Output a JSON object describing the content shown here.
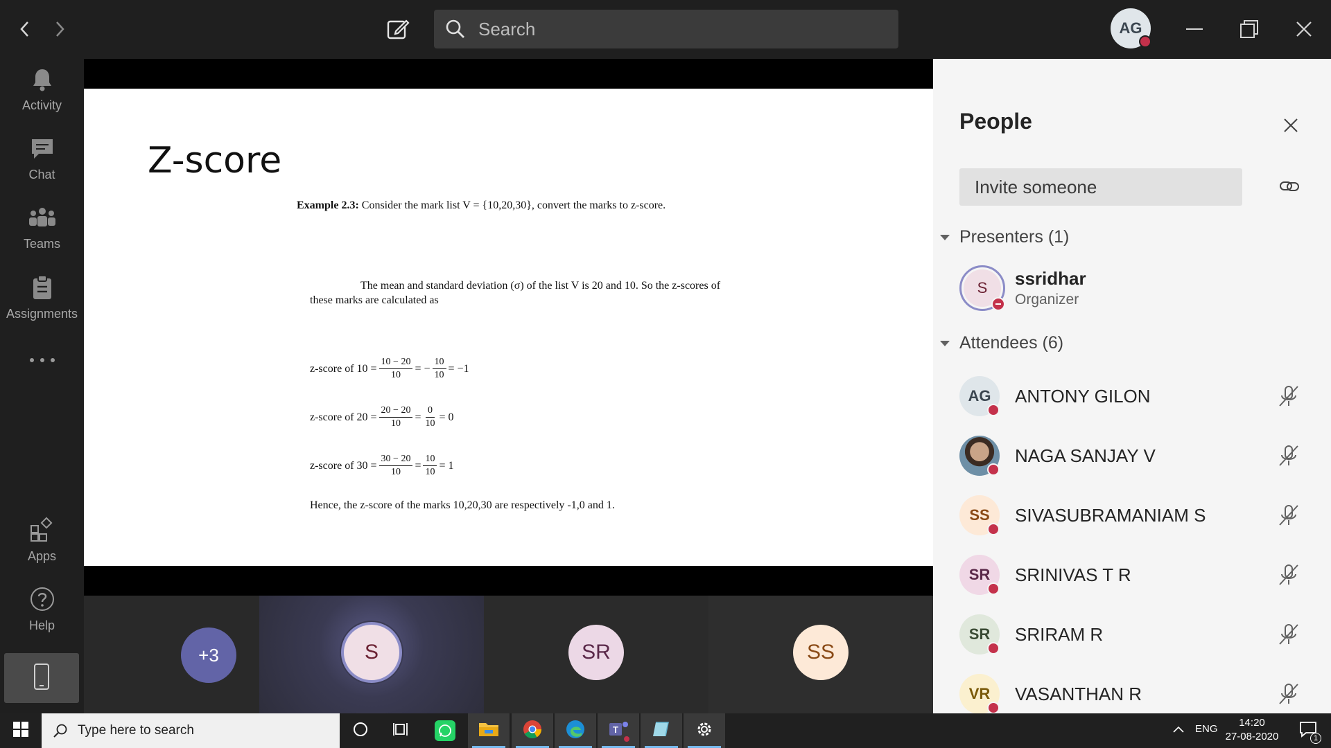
{
  "titlebar": {
    "search_placeholder": "Search",
    "me_initials": "AG"
  },
  "rail": {
    "items": [
      {
        "label": "Activity",
        "icon": "bell-icon"
      },
      {
        "label": "Chat",
        "icon": "chat-icon"
      },
      {
        "label": "Teams",
        "icon": "teams-icon"
      },
      {
        "label": "Assignments",
        "icon": "assignments-icon"
      },
      {
        "label": "Apps",
        "icon": "apps-icon"
      },
      {
        "label": "Help",
        "icon": "help-icon"
      }
    ]
  },
  "slide": {
    "title": "Z-score",
    "example_bold": "Example 2.3:",
    "example_text": " Consider the mark list V = {10,20,30}, convert the marks to z-score.",
    "desc": "The mean and standard deviation (σ) of the list V is 20 and 10. So the z-scores of these marks are calculated as",
    "rows": [
      {
        "label": "z-score of 10 =",
        "num1": "10 − 20",
        "den1": "10",
        "mid": "= −",
        "num2": "10",
        "den2": "10",
        "result": "= −1"
      },
      {
        "label": "z-score of 20 =",
        "num1": "20 − 20",
        "den1": "10",
        "mid": "=",
        "num2": "0",
        "den2": "10",
        "result": "= 0"
      },
      {
        "label": "z-score of 30 =",
        "num1": "30 − 20",
        "den1": "10",
        "mid": "=",
        "num2": "10",
        "den2": "10",
        "result": "= 1"
      }
    ],
    "conclusion": "Hence, the z-score of the marks 10,20,30 are respectively -1,0 and 1."
  },
  "gallery": {
    "overflow_count": "+3",
    "tiles": [
      {
        "initials": "S",
        "bg": "#f0dfe6",
        "color": "#6b2233"
      },
      {
        "initials": "SR",
        "bg": "#ecd8e6",
        "color": "#5a2849"
      },
      {
        "initials": "SS",
        "bg": "#fde9d7",
        "color": "#8a4a16"
      }
    ]
  },
  "people": {
    "title": "People",
    "invite_placeholder": "Invite someone",
    "presenters_header": "Presenters (1)",
    "attendees_header": "Attendees (6)",
    "presenters": [
      {
        "initials": "S",
        "name": "ssridhar",
        "role": "Organizer",
        "bg": "#f0dfe6",
        "color": "#6b2233"
      }
    ],
    "attendees": [
      {
        "initials": "AG",
        "name": "ANTONY GILON",
        "bg": "#dfe6ea",
        "color": "#3b4650"
      },
      {
        "initials": "",
        "name": "NAGA SANJAY V",
        "bg": "#8a6a50",
        "color": "#fff"
      },
      {
        "initials": "SS",
        "name": "SIVASUBRAMANIAM S",
        "bg": "#fde9d7",
        "color": "#8a4a16"
      },
      {
        "initials": "SR",
        "name": "SRINIVAS T R",
        "bg": "#f0d8e6",
        "color": "#5a2849"
      },
      {
        "initials": "SR",
        "name": "SRIRAM R",
        "bg": "#e0e8dc",
        "color": "#3a4a34"
      },
      {
        "initials": "VR",
        "name": "VASANTHAN R",
        "bg": "#fbf0cf",
        "color": "#7a5a0a"
      }
    ]
  },
  "taskbar": {
    "search_placeholder": "Type here to search",
    "language": "ENG",
    "time": "14:20",
    "date": "27-08-2020",
    "notification_count": "1"
  },
  "colors": {
    "accent": "#6264a7",
    "busy_red": "#c4314b"
  }
}
